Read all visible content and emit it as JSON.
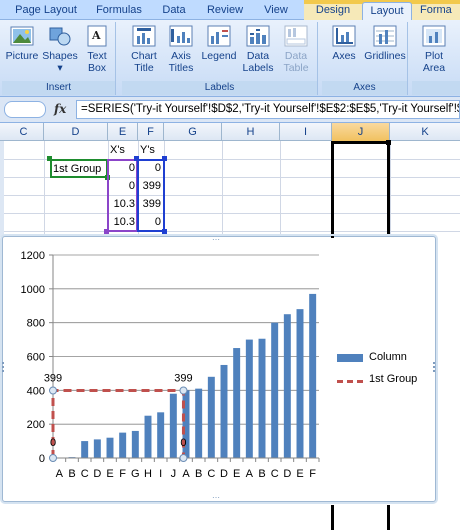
{
  "ribbon": {
    "tabs": [
      "Page Layout",
      "Formulas",
      "Data",
      "Review",
      "View",
      "Design",
      "Layout",
      "Forma"
    ],
    "active_tab": "Layout",
    "groups": {
      "insert": {
        "label": "Insert",
        "buttons": [
          "Picture",
          "Shapes",
          "Text Box"
        ]
      },
      "labels": {
        "label": "Labels",
        "buttons": [
          "Chart Title",
          "Axis Titles",
          "Legend",
          "Data Labels",
          "Data Table"
        ]
      },
      "axes": {
        "label": "Axes",
        "buttons": [
          "Axes",
          "Gridlines"
        ]
      },
      "background": {
        "buttons": [
          "Plot Area"
        ]
      }
    }
  },
  "formula_bar": {
    "fx": "fx",
    "formula": "=SERIES('Try-it Yourself'!$D$2,'Try-it Yourself'!$E$2:$E$5,'Try-it Yourself'!$F$2:$F$5,2)"
  },
  "grid": {
    "columns": [
      "C",
      "D",
      "E",
      "F",
      "G",
      "H",
      "I",
      "J",
      "K"
    ],
    "selected_column": "J",
    "header_row": {
      "e": "X's",
      "f": "Y's"
    },
    "series_name": "1st Group",
    "rows": [
      {
        "x": "0",
        "y": "0"
      },
      {
        "x": "0",
        "y": "399"
      },
      {
        "x": "10.3",
        "y": "399"
      },
      {
        "x": "10.3",
        "y": "0"
      }
    ]
  },
  "chart_data": {
    "type": "bar",
    "categories": [
      "A",
      "B",
      "C",
      "D",
      "E",
      "F",
      "G",
      "H",
      "I",
      "J",
      "A",
      "B",
      "C",
      "D",
      "E",
      "A",
      "B",
      "C",
      "D",
      "E",
      "F"
    ],
    "ylim": [
      0,
      1200
    ],
    "yticks": [
      "0",
      "200",
      "400",
      "600",
      "800",
      "1000",
      "1200"
    ],
    "grid": true,
    "legend_position": "right",
    "series": [
      {
        "name": "Column",
        "type": "bar",
        "color": "#4f81bd",
        "values": [
          0,
          5,
          100,
          110,
          120,
          150,
          160,
          250,
          270,
          380,
          400,
          410,
          480,
          550,
          650,
          700,
          705,
          800,
          850,
          880,
          970
        ]
      },
      {
        "name": "1st Group",
        "type": "scatter-line",
        "color": "#c0504d",
        "x": [
          0,
          0,
          10.3,
          10.3
        ],
        "y": [
          0,
          399,
          399,
          0
        ],
        "data_labels": [
          "0",
          "399",
          "399",
          "0"
        ]
      }
    ]
  }
}
